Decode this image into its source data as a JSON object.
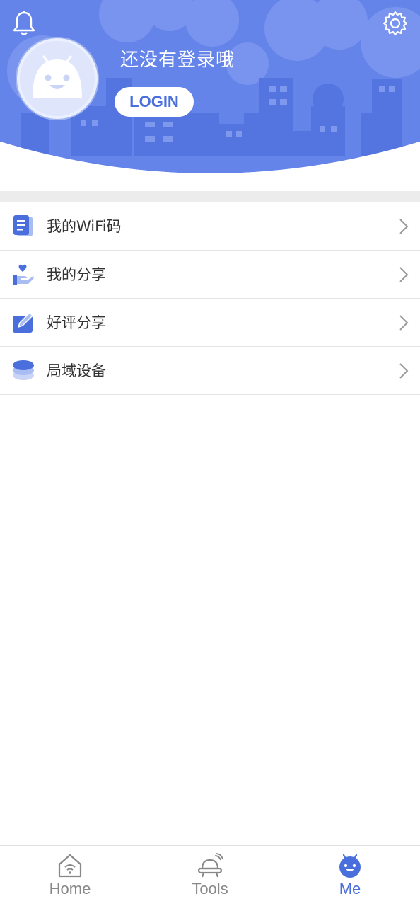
{
  "colors": {
    "brand": "#4a6fdc",
    "header_bg": "#6584ea",
    "separator": "#ececec"
  },
  "header": {
    "welcome_text": "还没有登录哦",
    "login_label": "LOGIN",
    "icons": {
      "left": "bell-icon",
      "right": "gear-icon",
      "avatar": "robot-avatar-icon"
    }
  },
  "menu": {
    "items": [
      {
        "label": "我的WiFi码",
        "icon": "document-icon"
      },
      {
        "label": "我的分享",
        "icon": "hand-heart-icon"
      },
      {
        "label": "好评分享",
        "icon": "edit-pencil-icon"
      },
      {
        "label": "局域设备",
        "icon": "stack-layers-icon"
      }
    ]
  },
  "bottom_nav": {
    "items": [
      {
        "label": "Home",
        "icon": "home-wifi-icon",
        "active": false
      },
      {
        "label": "Tools",
        "icon": "tools-ufo-icon",
        "active": false
      },
      {
        "label": "Me",
        "icon": "robot-face-icon",
        "active": true
      }
    ]
  }
}
